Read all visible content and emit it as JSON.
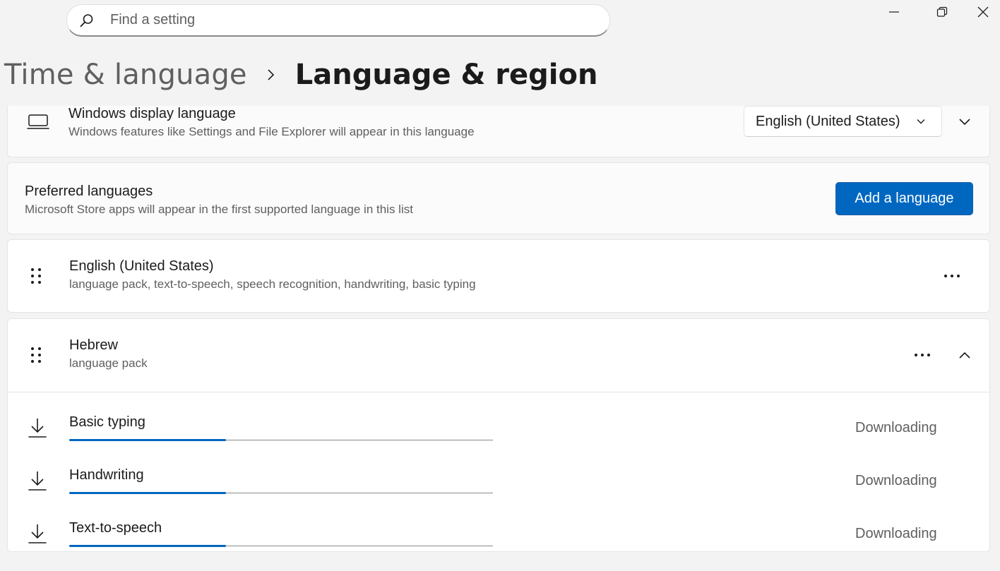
{
  "search": {
    "placeholder": "Find a setting",
    "icon": "search-icon"
  },
  "window_controls": {
    "minimize": "minimize-icon",
    "restore": "restore-icon",
    "close": "close-icon"
  },
  "breadcrumb": {
    "parent": "Time & language",
    "current": "Language & region"
  },
  "display_language": {
    "title": "Windows display language",
    "description": "Windows features like Settings and File Explorer will appear in this language",
    "selected": "English (United States)",
    "icon": "laptop-icon"
  },
  "preferred_languages": {
    "title": "Preferred languages",
    "description": "Microsoft Store apps will appear in the first supported language in this list",
    "add_button": "Add a language"
  },
  "languages": [
    {
      "name": "English (United States)",
      "features": "language pack, text-to-speech, speech recognition, handwriting, basic typing",
      "expanded": false
    },
    {
      "name": "Hebrew",
      "features": "language pack",
      "expanded": true,
      "downloads": [
        {
          "label": "Basic typing",
          "status": "Downloading",
          "progress": 0.37
        },
        {
          "label": "Handwriting",
          "status": "Downloading",
          "progress": 0.37
        },
        {
          "label": "Text-to-speech",
          "status": "Downloading",
          "progress": 0.37
        }
      ]
    }
  ],
  "colors": {
    "accent": "#0067c0",
    "background": "#f3f3f3",
    "secondary_text": "#5f5f5f"
  }
}
